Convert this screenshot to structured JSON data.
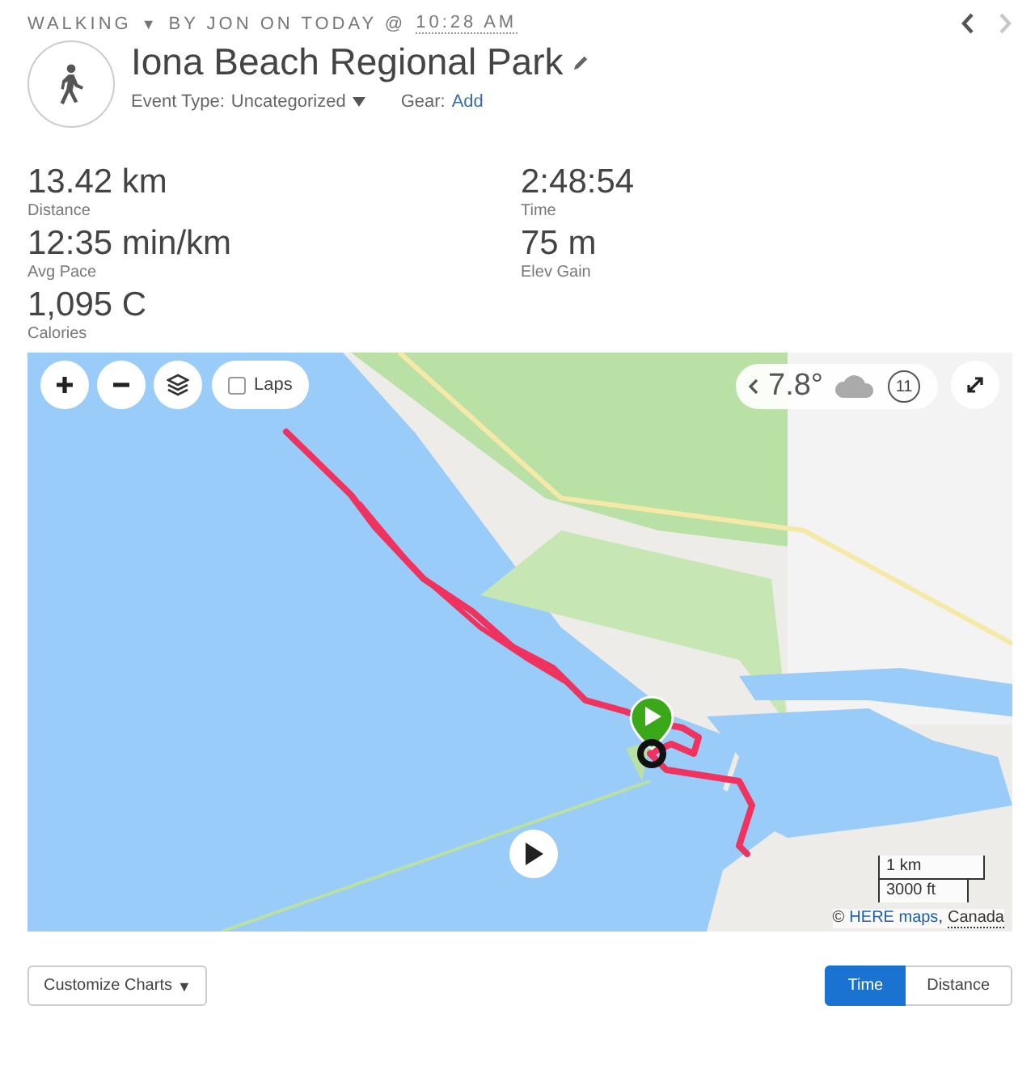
{
  "header": {
    "sport": "WALKING",
    "sport_caret": "▼",
    "byline": "BY JON ON TODAY @",
    "time": "10:28 AM",
    "prev_disabled": false,
    "next_disabled": true
  },
  "title": "Iona Beach Regional Park",
  "meta": {
    "event_type_label": "Event Type:",
    "event_type_value": "Uncategorized",
    "gear_label": "Gear:",
    "gear_link": "Add"
  },
  "stats": [
    {
      "value": "13.42 km",
      "label": "Distance"
    },
    {
      "value": "2:48:54",
      "label": "Time"
    },
    {
      "value": "12:35 min/km",
      "label": "Avg Pace"
    },
    {
      "value": "75 m",
      "label": "Elev Gain"
    },
    {
      "value": "1,095 C",
      "label": "Calories"
    }
  ],
  "map": {
    "laps": {
      "label": "Laps",
      "checked": false
    },
    "weather": {
      "temperature": "7.8°",
      "wind": "11"
    },
    "scale": [
      "1 km",
      "3000 ft"
    ],
    "attribution": {
      "prefix": "©",
      "link": "HERE maps",
      "separator": ",",
      "region": "Canada"
    }
  },
  "chart_controls": {
    "customize": "Customize Charts",
    "caret": "▼",
    "toggle": [
      {
        "label": "Time",
        "selected": true
      },
      {
        "label": "Distance",
        "selected": false
      }
    ]
  }
}
